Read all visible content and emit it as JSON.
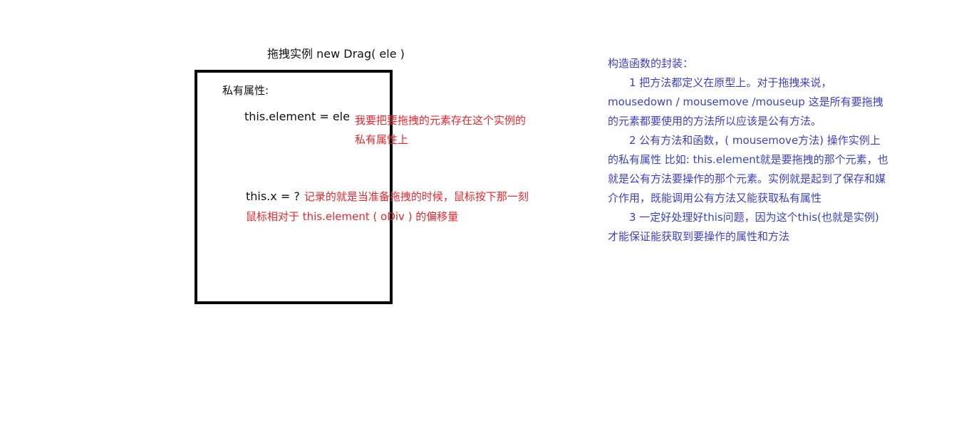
{
  "diagram": {
    "title": "拖拽实例  new Drag( ele )",
    "private_label": "私有属性:",
    "element_code": "this.element = ele",
    "element_note": "我要把要拖拽的元素存在这个实例的私有属性上",
    "x_code": "this.x = ?",
    "x_note": "记录的就是当准备拖拽的时候，鼠标按下那一刻鼠标相对于 this.element ( oDiv ) 的偏移量"
  },
  "notes": {
    "heading": "构造函数的封装：",
    "p1": "1  把方法都定义在原型上。对于拖拽来说，mousedown / mousemove /mouseup 这是所有要拖拽的元素都要使用的方法所以应该是公有方法。",
    "p2": "2  公有方法和函数，( mousemove方法) 操作实例上的私有属性  比如: this.element就是要拖拽的那个元素，也就是公有方法要操作的那个元素。实例就是起到了保存和媒介作用，既能调用公有方法又能获取私有属性",
    "p3": "3  一定好处理好this问题，因为这个this(也就是实例)才能保证能获取到要操作的属性和方法"
  },
  "colors": {
    "note_red": "#e8262e",
    "note_blue": "#3d3fc8",
    "box_border": "#000000"
  }
}
